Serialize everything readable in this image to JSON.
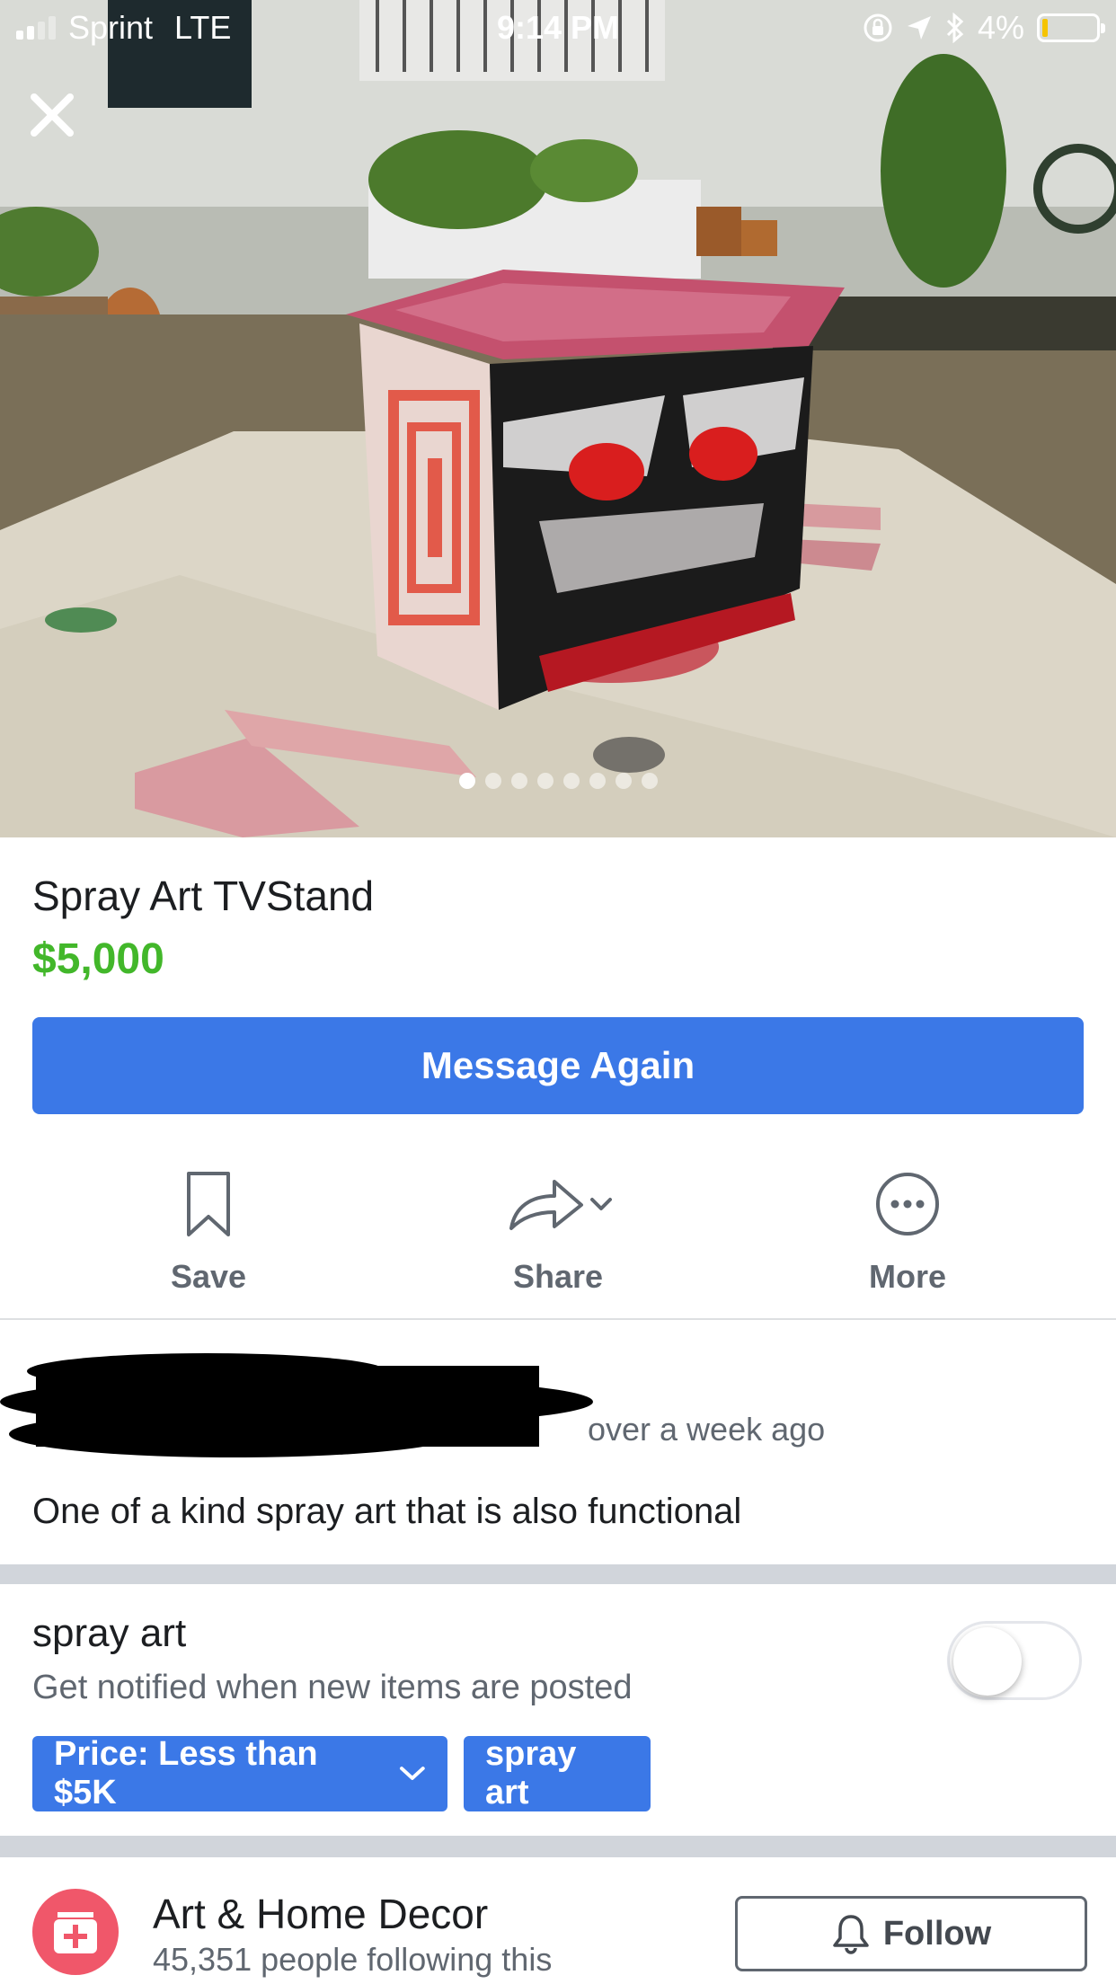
{
  "status_bar": {
    "carrier": "Sprint",
    "network": "LTE",
    "time": "9:14 PM",
    "battery": "4%"
  },
  "photo": {
    "image_count": 8,
    "active_index": 0
  },
  "listing": {
    "title": "Spray Art TVStand",
    "price": "$5,000",
    "price_color": "#42b72a",
    "message_button": "Message Again"
  },
  "actions": {
    "save": "Save",
    "share": "Share",
    "more": "More"
  },
  "seller": {
    "posted": "over a week ago"
  },
  "description": "One of a kind spray art that is also functional",
  "saved_search": {
    "title": "spray art",
    "subtitle": "Get notified when new items are posted",
    "notify_enabled": false,
    "chips": {
      "price": "Price: Less than $5K",
      "keyword": "spray art"
    }
  },
  "category": {
    "name": "Art & Home Decor",
    "followers": "45,351 people following this",
    "follow_button": "Follow"
  },
  "colors": {
    "accent": "#3b78e7",
    "category_icon": "#f0576a"
  }
}
